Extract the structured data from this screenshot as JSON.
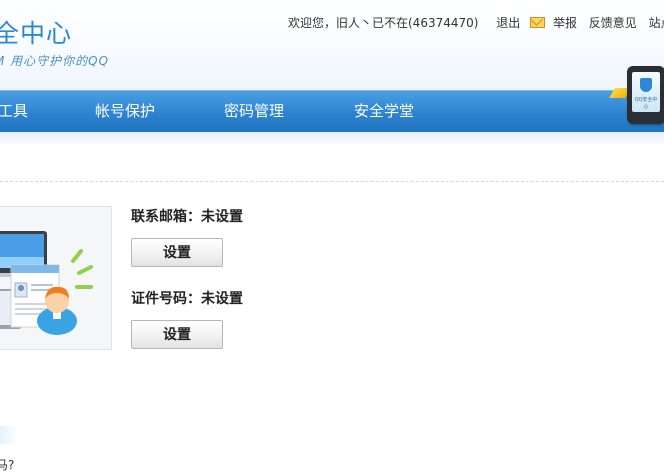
{
  "header": {
    "logo_title": "全中心",
    "logo_slogan": "M 用心守护你的QQ"
  },
  "topbar": {
    "welcome": "欢迎您，旧人丶已不在(46374470)",
    "logout": "退出",
    "report": "举报",
    "feedback": "反馈意见",
    "site": "站点"
  },
  "nav": {
    "items": [
      "工具",
      "帐号保护",
      "密码管理",
      "安全学堂"
    ]
  },
  "phone": {
    "label": "QQ安全中心"
  },
  "main": {
    "email_label": "联系邮箱：未设置",
    "email_button": "设置",
    "id_label": "证件号码：未设置",
    "id_button": "设置"
  },
  "footer": {
    "partial_text": "马?"
  },
  "colors": {
    "brand": "#2b88d6",
    "nav_bg": "#2d83cf"
  }
}
